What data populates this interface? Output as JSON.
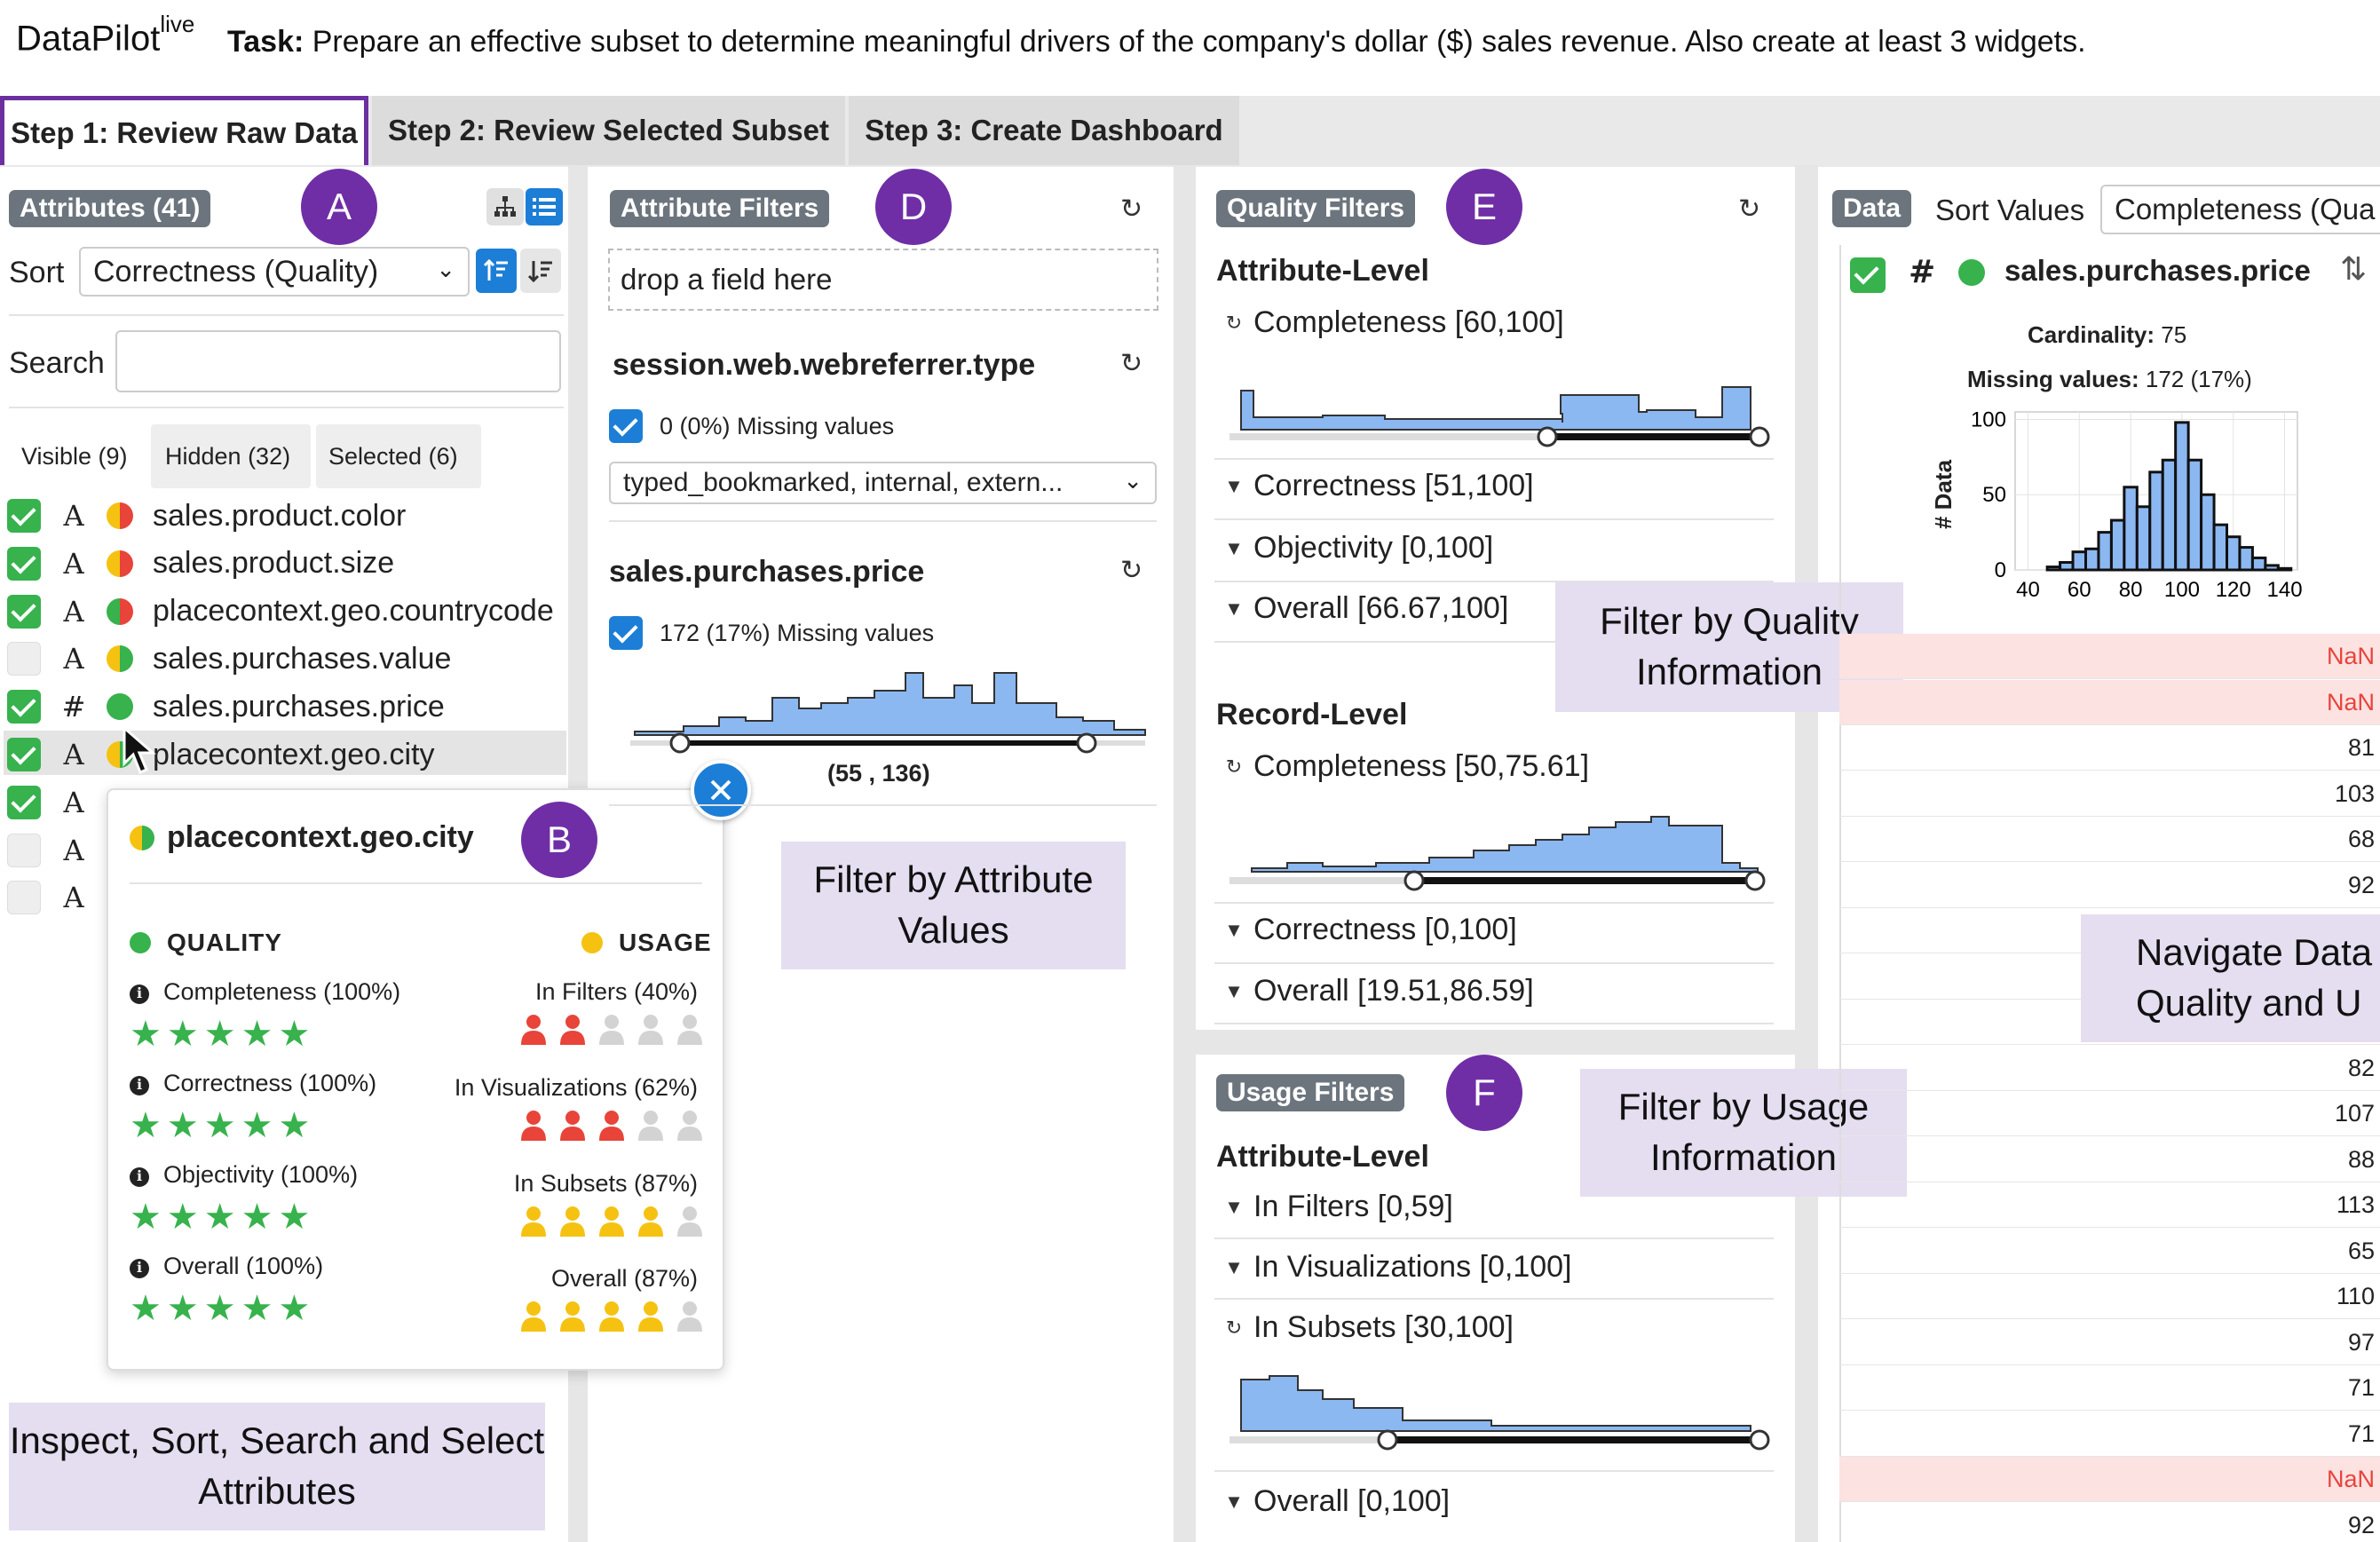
{
  "app": {
    "name": "DataPilot",
    "superscript": "live"
  },
  "task": {
    "label": "Task:",
    "text": "Prepare an effective subset to determine meaningful drivers of the company's dollar ($) sales revenue. Also create at least 3 widgets."
  },
  "tabs": [
    "Step 1: Review Raw Data",
    "Step 2: Review Selected Subset",
    "Step 3: Create Dashboard"
  ],
  "colors": {
    "accent": "#6f2ea6",
    "label_bg": "#e5ddf0",
    "ok": "#37b24d",
    "bar": "#8cb8f2",
    "nan_bg": "#fde2e2"
  },
  "attributes": {
    "pill": "Attributes (41)",
    "badge": "A",
    "sort_label": "Sort",
    "sort_value": "Correctness (Quality)",
    "search_label": "Search",
    "search_value": "",
    "subtabs": [
      "Visible (9)",
      "Hidden (32)",
      "Selected (6)"
    ],
    "items": [
      {
        "name": "sales.product.color",
        "type": "A",
        "checked": true,
        "quality": "half"
      },
      {
        "name": "sales.product.size",
        "type": "A",
        "checked": true,
        "quality": "half"
      },
      {
        "name": "placecontext.geo.countrycode",
        "type": "A",
        "checked": true,
        "quality": "half-rg"
      },
      {
        "name": "sales.purchases.value",
        "type": "A",
        "checked": false,
        "quality": "half-g"
      },
      {
        "name": "sales.purchases.price",
        "type": "#",
        "checked": true,
        "quality": "green"
      },
      {
        "name": "placecontext.geo.city",
        "type": "A",
        "checked": true,
        "quality": "half-g"
      },
      {
        "name": "",
        "type": "A",
        "checked": true,
        "quality": ""
      },
      {
        "name": "",
        "type": "A",
        "checked": false,
        "quality": ""
      },
      {
        "name": "",
        "type": "A",
        "checked": false,
        "quality": ""
      }
    ],
    "callout": "Inspect, Sort, Search and Select Attributes"
  },
  "popup": {
    "title": "placecontext.geo.city",
    "badge": "B",
    "quality_header": "QUALITY",
    "usage_header": "USAGE",
    "quality": [
      {
        "label": "Completeness (100%)",
        "stars": 5
      },
      {
        "label": "Correctness (100%)",
        "stars": 5
      },
      {
        "label": "Objectivity (100%)",
        "stars": 5
      },
      {
        "label": "Overall (100%)",
        "stars": 5
      }
    ],
    "usage": [
      {
        "label": "In Filters (40%)",
        "filled": 2,
        "color": "red"
      },
      {
        "label": "In Visualizations (62%)",
        "filled": 3,
        "color": "red"
      },
      {
        "label": "In Subsets (87%)",
        "filled": 4,
        "color": "yellow"
      },
      {
        "label": "Overall (87%)",
        "filled": 4,
        "color": "yellow"
      }
    ]
  },
  "attr_filters": {
    "pill": "Attribute Filters",
    "badge": "D",
    "drop": "drop a field here",
    "f1": {
      "title": "session.web.webreferrer.type",
      "missing": "0 (0%) Missing values",
      "select": "typed_bookmarked, internal, extern..."
    },
    "f2": {
      "title": "sales.purchases.price",
      "missing": "172 (17%) Missing values",
      "range": "(55 , 136)",
      "range_low": 55,
      "range_high": 136
    },
    "callout": "Filter by Attribute Values"
  },
  "quality_filters": {
    "pill": "Quality Filters",
    "badge": "E",
    "attr_level": "Attribute-Level",
    "attr": [
      {
        "label": "Completeness [60,100]",
        "icon": "reset"
      },
      {
        "label": "Correctness [51,100]",
        "icon": "filter"
      },
      {
        "label": "Objectivity [0,100]",
        "icon": "filter"
      },
      {
        "label": "Overall [66.67,100]",
        "icon": "filter"
      }
    ],
    "record_level": "Record-Level",
    "record": [
      {
        "label": "Completeness [50,75.61]",
        "icon": "reset"
      },
      {
        "label": "Correctness [0,100]",
        "icon": "filter"
      },
      {
        "label": "Overall [19.51,86.59]",
        "icon": "filter"
      }
    ],
    "callout": "Filter by Quality Information"
  },
  "usage_filters": {
    "pill": "Usage Filters",
    "badge": "F",
    "attr_level": "Attribute-Level",
    "items": [
      {
        "label": "In Filters [0,59]",
        "icon": "filter"
      },
      {
        "label": "In Visualizations [0,100]",
        "icon": "filter"
      },
      {
        "label": "In Subsets [30,100]",
        "icon": "reset"
      },
      {
        "label": "Overall [0,100]",
        "icon": "filter"
      }
    ],
    "callout": "Filter by Usage Information"
  },
  "data_panel": {
    "pill": "Data",
    "sort_label": "Sort Values",
    "sort_value": "Completeness (Qua",
    "column": "sales.purchases.price",
    "type": "#",
    "cardinality_label": "Cardinality:",
    "cardinality": "75",
    "missing_label": "Missing values:",
    "missing": "172 (17%)",
    "ylabel": "# Data",
    "yticks": [
      "0",
      "50",
      "100"
    ],
    "xticks": [
      "40",
      "60",
      "80",
      "100",
      "120",
      "140"
    ],
    "values": [
      "NaN",
      "NaN",
      "81",
      "103",
      "68",
      "92",
      "",
      "",
      "",
      "82",
      "107",
      "88",
      "113",
      "65",
      "110",
      "97",
      "71",
      "71",
      "NaN",
      "92"
    ],
    "callout": "Navigate Data Quality and U"
  },
  "chart_data": {
    "type": "bar",
    "title": "",
    "xlabel": "",
    "ylabel": "# Data",
    "x": [
      45,
      50,
      55,
      60,
      65,
      70,
      75,
      80,
      85,
      90,
      95,
      100,
      105,
      110,
      115,
      120,
      125,
      130,
      135,
      140
    ],
    "series": [
      {
        "values": [
          0,
          2,
          5,
          12,
          14,
          25,
          33,
          55,
          42,
          65,
          73,
          98,
          73,
          50,
          30,
          22,
          15,
          8,
          3,
          1
        ]
      }
    ],
    "xlim": [
      35,
      145
    ],
    "ylim": [
      0,
      105
    ]
  }
}
